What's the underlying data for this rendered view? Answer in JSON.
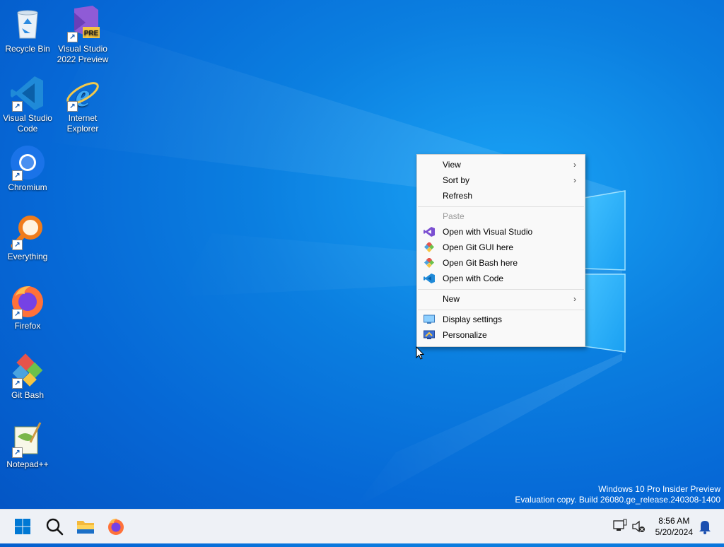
{
  "desktop": {
    "icons": [
      {
        "label": "Recycle Bin",
        "icon": "recycle-bin-icon"
      },
      {
        "label": "Visual Studio 2022 Preview",
        "icon": "visual-studio-preview-icon",
        "badge": "PRE"
      },
      {
        "label": "Visual Studio Code",
        "icon": "vscode-icon"
      },
      {
        "label": "Internet Explorer",
        "icon": "internet-explorer-icon"
      },
      {
        "label": "Chromium",
        "icon": "chromium-icon"
      },
      {
        "label": "Everything",
        "icon": "everything-search-icon"
      },
      {
        "label": "Firefox",
        "icon": "firefox-icon"
      },
      {
        "label": "Git Bash",
        "icon": "git-bash-icon"
      },
      {
        "label": "Notepad++",
        "icon": "notepadpp-icon"
      }
    ]
  },
  "context_menu": {
    "items": [
      {
        "label": "View",
        "submenu": true
      },
      {
        "label": "Sort by",
        "submenu": true
      },
      {
        "label": "Refresh"
      },
      {
        "label": "Paste",
        "disabled": true
      },
      {
        "label": "Open with Visual Studio",
        "icon": "visual-studio-icon"
      },
      {
        "label": "Open Git GUI here",
        "icon": "git-gui-icon"
      },
      {
        "label": "Open Git Bash here",
        "icon": "git-bash-icon"
      },
      {
        "label": "Open with Code",
        "icon": "vscode-icon"
      },
      {
        "label": "New",
        "submenu": true
      },
      {
        "label": "Display settings",
        "icon": "display-settings-icon"
      },
      {
        "label": "Personalize",
        "icon": "personalize-icon"
      }
    ],
    "submenu_arrow": "›"
  },
  "watermark": {
    "line1": "Windows 10 Pro Insider Preview",
    "line2": "Evaluation copy. Build 26080.ge_release.240308-1400"
  },
  "taskbar": {
    "buttons": [
      "start-icon",
      "search-icon",
      "file-explorer-icon",
      "firefox-icon"
    ],
    "clock": {
      "time": "8:56 AM",
      "date": "5/20/2024"
    },
    "tray": [
      "network-icon",
      "volume-muted-icon",
      "notification-bell-icon"
    ]
  },
  "colors": {
    "desktop_blue": "#0b7fe0",
    "menu_bg": "#f9f9f9",
    "taskbar_bg": "#eef1f6",
    "start_blue": "#0078d4"
  }
}
